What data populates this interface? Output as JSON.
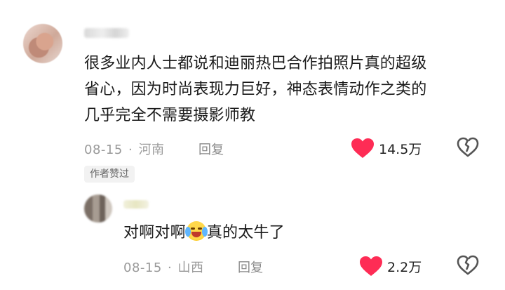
{
  "comments": [
    {
      "text_lines": [
        "很多业内人士都说和迪丽热巴合作拍照片真的超级",
        "省心，因为时尚表现力巨好，神态表情动作之类的",
        "几乎完全不需要摄影师教"
      ],
      "date": "08-15",
      "separator": "·",
      "location": "河南",
      "reply_label": "回复",
      "likes": "14.5万",
      "like_icon": "heart-icon",
      "dislike_icon": "broken-heart-icon"
    },
    {
      "badge": "作者赞过",
      "text_before": "对啊对啊",
      "emoji": "laughing-crying-emoji",
      "text_after": "真的太牛了",
      "date": "08-15",
      "separator": "·",
      "location": "山西",
      "reply_label": "回复",
      "likes": "2.2万",
      "like_icon": "heart-icon",
      "dislike_icon": "broken-heart-icon"
    }
  ],
  "colors": {
    "like": "#fe2c55",
    "meta": "#9a9a9a",
    "text": "#1a1a1a",
    "badge_bg": "#f2f2f2"
  }
}
